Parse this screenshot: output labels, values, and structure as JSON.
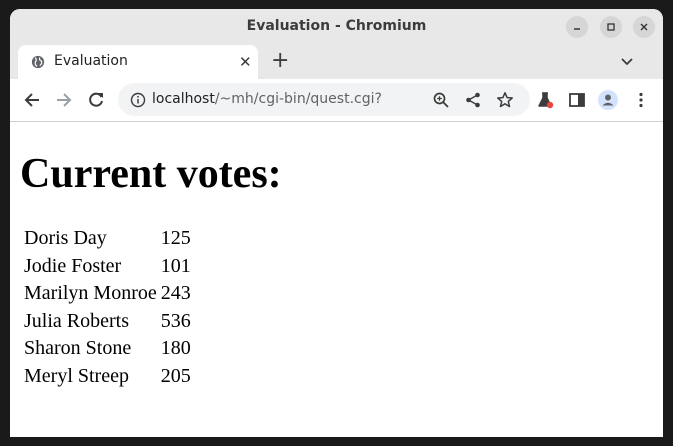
{
  "window": {
    "title": "Evaluation - Chromium"
  },
  "tab": {
    "title": "Evaluation",
    "close_glyph": "✕",
    "new_tab_glyph": "+"
  },
  "toolbar": {
    "url_host": "localhost",
    "url_path": "/~mh/cgi-bin/quest.cgi?"
  },
  "page": {
    "heading": "Current votes:",
    "votes": [
      {
        "name": "Doris Day",
        "count": "125"
      },
      {
        "name": "Jodie Foster",
        "count": "101"
      },
      {
        "name": "Marilyn Monroe",
        "count": "243"
      },
      {
        "name": "Julia Roberts",
        "count": "536"
      },
      {
        "name": "Sharon Stone",
        "count": "180"
      },
      {
        "name": "Meryl Streep",
        "count": "205"
      }
    ]
  },
  "colors": {
    "titlebar": "#e8e8e8",
    "omnibox": "#f1f3f4",
    "labs_badge": "#e8453c"
  },
  "icons": [
    "globe-icon",
    "close-icon",
    "plus-icon",
    "chevron-down-icon",
    "back-icon",
    "forward-icon",
    "reload-icon",
    "info-icon",
    "zoom-icon",
    "share-icon",
    "star-icon",
    "labs-icon",
    "side-panel-icon",
    "profile-icon",
    "menu-icon",
    "minimize-icon",
    "maximize-icon"
  ]
}
